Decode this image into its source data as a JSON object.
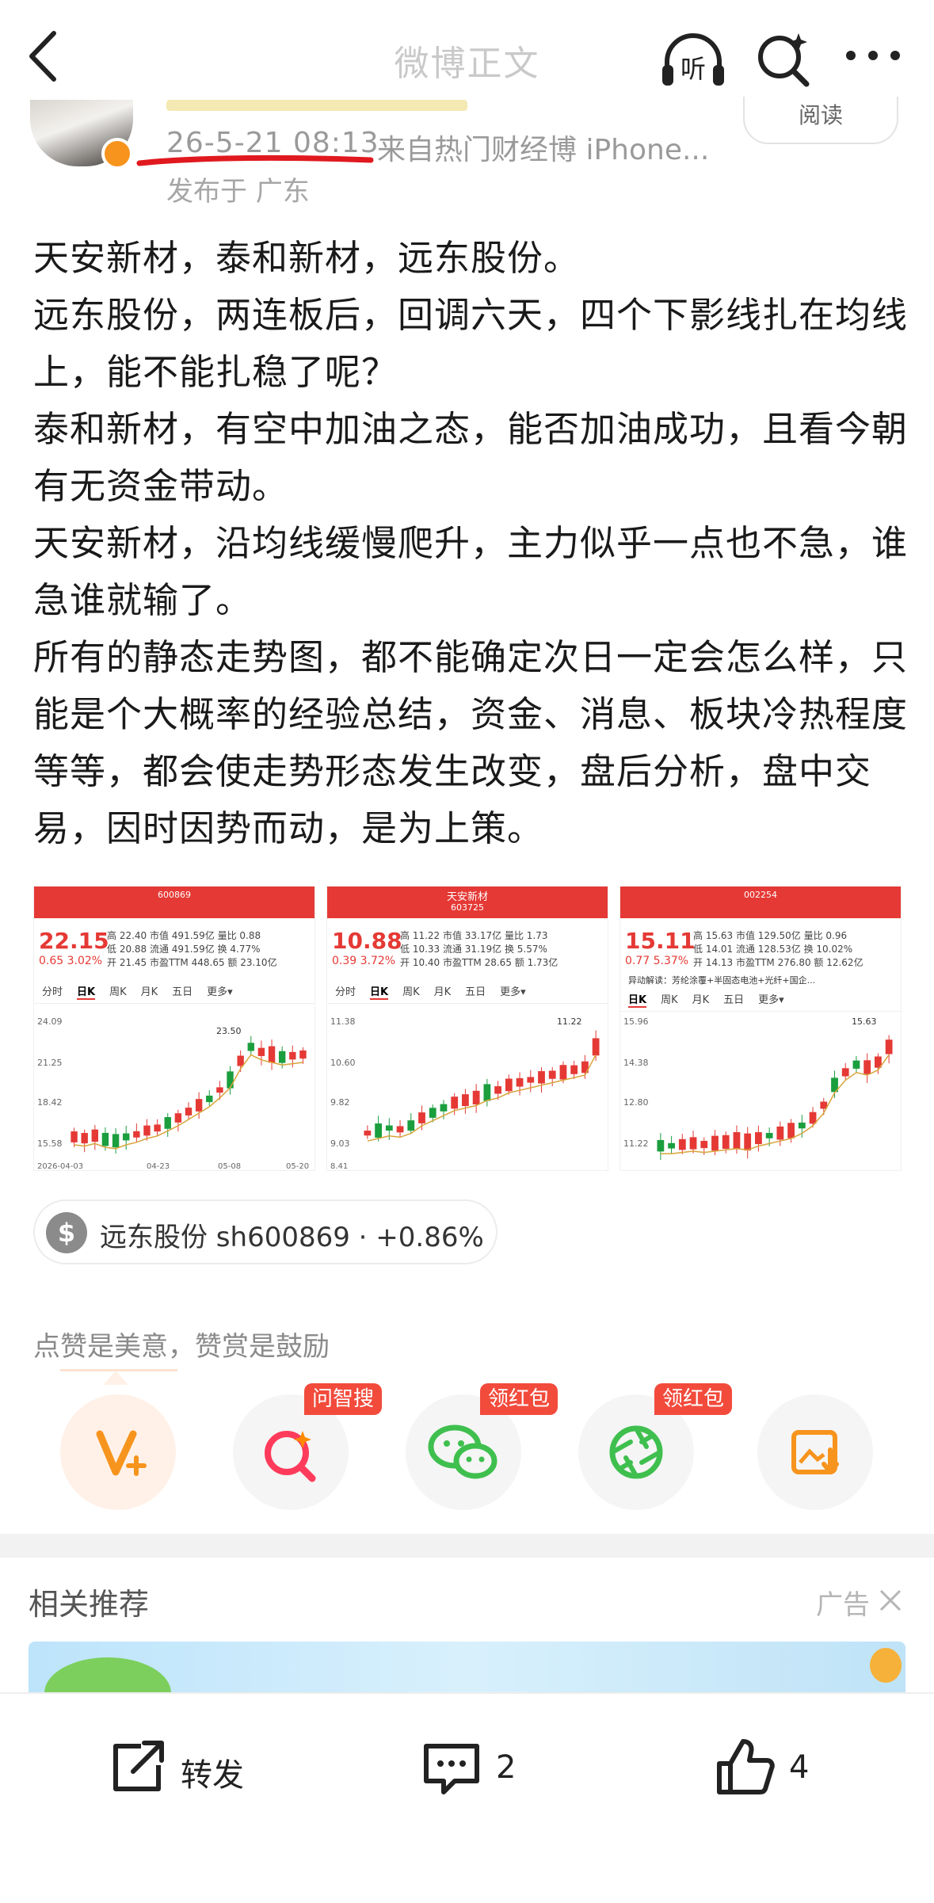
{
  "header": {
    "title": "微博正文",
    "listen_label": "听"
  },
  "post": {
    "time": "26-5-21 08:13",
    "source": "来自热门财经博 iPhone...",
    "location": "发布于 广东",
    "read_label": "阅读",
    "body": [
      "天安新材，泰和新材，远东股份。",
      "远东股份，两连板后，回调六天，四个下影线扎在均线上，能不能扎稳了呢？",
      "泰和新材，有空中加油之态，能否加油成功，且看今朝有无资金带动。",
      "天安新材，沿均线缓慢爬升，主力似乎一点也不急，谁急谁就输了。",
      "所有的静态走势图，都不能确定次日一定会怎么样，只能是个大概率的经验总结，资金、消息、板块冷热程度等等，都会使走势形态发生改变，盘后分析，盘中交易，因时因势而动，是为上策。"
    ]
  },
  "images": [
    {
      "code": "600869",
      "price": "22.15",
      "change": "0.65  3.02%",
      "quote": [
        "高 22.40  市值 491.59亿  量比 0.88",
        "低 20.88  流通 491.59亿  换 4.77%",
        "开 21.45  市盈TTM 448.65  额 23.10亿"
      ],
      "tabs": [
        "分时",
        "日K",
        "周K",
        "月K",
        "五日",
        "更多▾"
      ],
      "top_label": "23.50",
      "y_labels": [
        "24.09",
        "21.25",
        "18.42",
        "15.58"
      ],
      "dates": [
        "2026-04-03",
        "04-23",
        "05-08",
        "05-20"
      ]
    },
    {
      "title": "天安新材",
      "code": "603725",
      "price": "10.88",
      "change": "0.39  3.72%",
      "quote": [
        "高 11.22  市值 33.17亿  量比 1.73",
        "低 10.33  流通 31.19亿  换 5.57%",
        "开 10.40  市盈TTM 28.65  额 1.73亿"
      ],
      "tabs": [
        "分时",
        "日K",
        "周K",
        "月K",
        "五日",
        "更多▾"
      ],
      "top_label": "11.22",
      "y_labels": [
        "11.38",
        "10.60",
        "9.82",
        "9.03"
      ],
      "dates": [
        "8.41"
      ]
    },
    {
      "code": "002254",
      "price": "15.11",
      "change": "0.77  5.37%",
      "quote": [
        "高 15.63  市值 129.50亿  量比 0.96",
        "低 14.01  流通 128.53亿  换 10.02%",
        "开 14.13  市盈TTM 276.80  额 12.62亿"
      ],
      "tabs": [
        "日K",
        "周K",
        "月K",
        "五日",
        "更多▾"
      ],
      "news": "异动解读：芳纶涂覆+半固态电池+光纤+国企...",
      "top_label": "15.63",
      "y_labels": [
        "15.96",
        "14.38",
        "12.80",
        "11.22"
      ],
      "dates": []
    }
  ],
  "stock_chip": {
    "label": "远东股份 sh600869 · +0.86%"
  },
  "reward": {
    "text": "点赞是美意，赞赏是鼓励",
    "badges": [
      "问智搜",
      "领红包",
      "领红包"
    ]
  },
  "recommend": {
    "title": "相关推荐",
    "ad_label": "广告"
  },
  "bottom_bar": {
    "repost_label": "转发",
    "comment_count": "2",
    "like_count": "4"
  },
  "colors": {
    "accent_red": "#e53935",
    "badge_red": "#f24b3c",
    "orange": "#f7941d",
    "wechat_green": "#3fbf4e"
  }
}
